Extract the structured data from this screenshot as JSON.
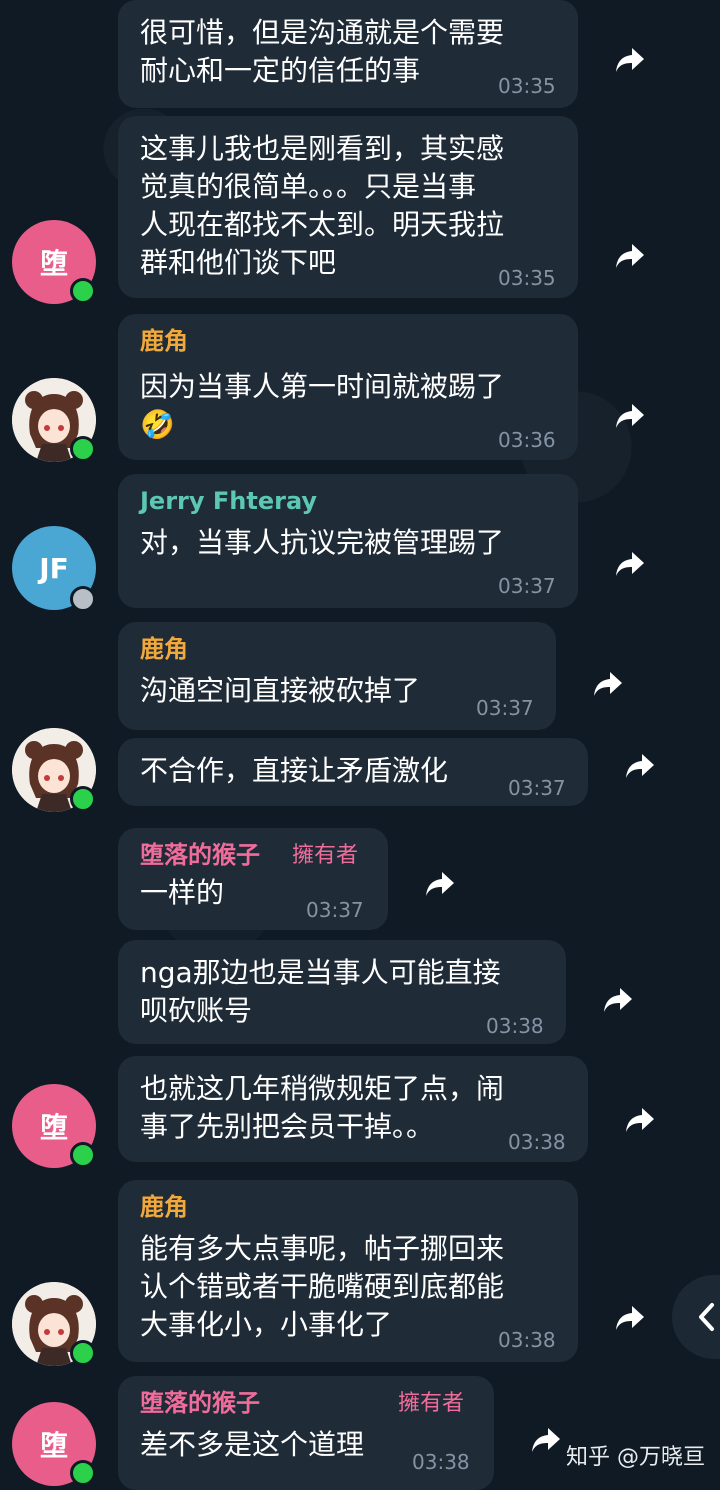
{
  "chat": {
    "messages": [
      {
        "text": "很可惜，但是沟通就是个需要\n耐心和一定的信任的事",
        "time": "03:35"
      },
      {
        "text": "这事儿我也是刚看到，其实感\n觉真的很简单。。。只是当事\n人现在都找不太到。明天我拉\n群和他们谈下吧",
        "time": "03:35"
      },
      {
        "sender": "鹿角",
        "text": "因为当事人第一时间就被踢了",
        "emoji": "🤣",
        "time": "03:36"
      },
      {
        "sender": "Jerry Fhteray",
        "text": "对，当事人抗议完被管理踢了",
        "time": "03:37"
      },
      {
        "sender": "鹿角",
        "text": "沟通空间直接被砍掉了",
        "time": "03:37"
      },
      {
        "text": "不合作，直接让矛盾激化",
        "time": "03:37"
      },
      {
        "sender": "堕落的猴子",
        "role": "擁有者",
        "text": "一样的",
        "time": "03:37"
      },
      {
        "text": "nga那边也是当事人可能直接\n呗砍账号",
        "time": "03:38"
      },
      {
        "text": "也就这几年稍微规矩了点，闹\n事了先别把会员干掉。。",
        "time": "03:38"
      },
      {
        "sender": "鹿角",
        "text": "能有多大点事呢，帖子挪回来\n认个错或者干脆嘴硬到底都能\n大事化小，小事化了",
        "time": "03:38"
      },
      {
        "sender": "堕落的猴子",
        "role": "擁有者",
        "text": "差不多是这个道理",
        "time": "03:38"
      }
    ],
    "avatars": {
      "pink_initial": "堕",
      "jf_initials": "JF"
    },
    "colors": {
      "name_luojiao": "#f2a93b",
      "name_jerry": "#5cc8b2",
      "name_monkey": "#f06d9b",
      "bubble": "#1f2b37",
      "background": "#0f1a24"
    },
    "watermark": "知乎 @万晓亘"
  }
}
